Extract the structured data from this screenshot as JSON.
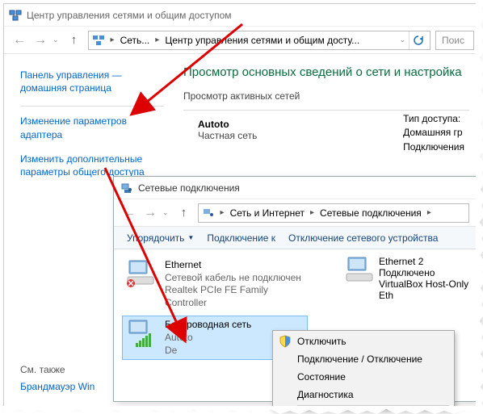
{
  "main_window": {
    "title": "Центр управления сетями и общим доступом",
    "breadcrumb": {
      "level1": "Сеть...",
      "level2": "Центр управления сетями и общим досту..."
    },
    "search_placeholder": "Поис",
    "sidebar": {
      "home": "Панель управления — домашняя страница",
      "adapter": "Изменение параметров адаптера",
      "sharing": "Изменить дополнительные параметры общего доступа",
      "see_also": "См. также",
      "firewall": "Брандмауэр Win"
    },
    "content": {
      "heading": "Просмотр основных сведений о сети и настройка",
      "active_nets": "Просмотр активных сетей",
      "net_name": "Autoto",
      "net_type": "Частная сеть",
      "access_type_label": "Тип доступа:",
      "homegroup_label": "Домашняя гр",
      "connections_label": "Подключения"
    }
  },
  "sub_window": {
    "title": "Сетевые подключения",
    "breadcrumb": {
      "level1": "Сеть и Интернет",
      "level2": "Сетевые подключения"
    },
    "toolbar": {
      "organize": "Упорядочить",
      "connect": "Подключение к",
      "disable": "Отключение сетевого устройства"
    },
    "adapters": [
      {
        "name": "Ethernet",
        "status": "Сетевой кабель не подключен",
        "device": "Realtek PCIe FE Family Controller"
      },
      {
        "name": "Ethernet 2",
        "status": "Подключено",
        "device": "VirtualBox Host-Only Eth"
      },
      {
        "name": "Беспроводная сеть",
        "status": "Autoto",
        "device": "De"
      }
    ],
    "context_menu": {
      "disable": "Отключить",
      "toggle": "Подключение / Отключение",
      "status": "Состояние",
      "diag": "Диагностика"
    }
  }
}
